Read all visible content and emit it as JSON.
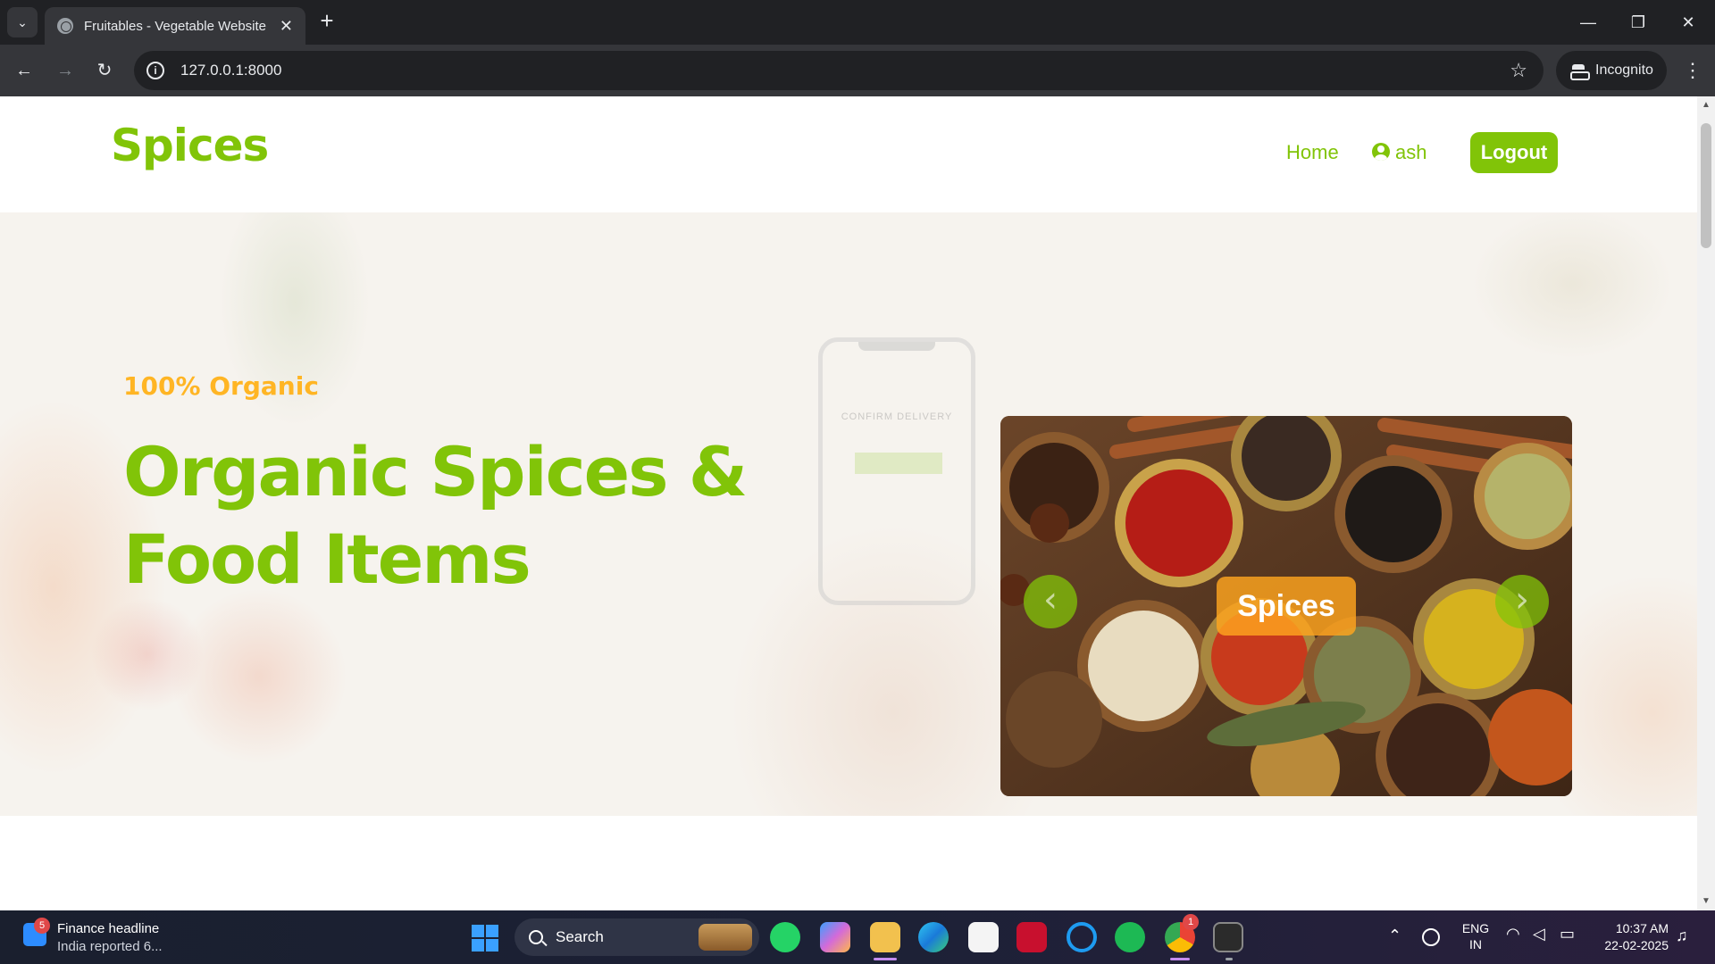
{
  "browser": {
    "tab_title": "Fruitables - Vegetable Website",
    "url": "127.0.0.1:8000",
    "incognito_label": "Incognito",
    "new_tab_symbol": "+",
    "tab_close_symbol": "✕"
  },
  "site": {
    "brand": "Spices",
    "nav": {
      "home": "Home",
      "user": "ash",
      "logout": "Logout"
    },
    "hero": {
      "subtitle": "100% Organic",
      "title": "Organic Spices & Food Items",
      "carousel_caption": "Spices",
      "prev_symbol": "‹",
      "next_symbol": "›"
    },
    "background_phone_text": "CONFIRM DELIVERY"
  },
  "colors": {
    "brand_green": "#81c408",
    "accent_orange": "#ffb524"
  },
  "taskbar": {
    "news_badge": "5",
    "news_title": "Finance headline",
    "news_subtitle": "India reported 6...",
    "search_label": "Search",
    "language_line1": "ENG",
    "language_line2": "IN",
    "time": "10:37 AM",
    "date": "22-02-2025",
    "chrome_badge": "1"
  }
}
